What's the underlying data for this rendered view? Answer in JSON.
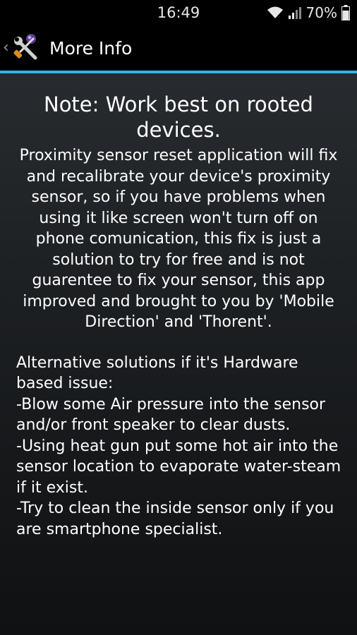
{
  "status_bar": {
    "time": "16:49",
    "battery_percent": "70%",
    "icons": [
      "wifi-icon",
      "signal-icon",
      "battery-icon"
    ]
  },
  "action_bar": {
    "title": "More Info",
    "up_indicator": "‹",
    "app_icon": "tools-icon",
    "accent_color": "#33b5e5"
  },
  "content": {
    "note": "Note: Work best on rooted devices.",
    "description": "Proximity sensor reset application will fix and recalibrate your device's proximity sensor, so if you have problems when using it like screen won't turn off on phone comunication, this fix is just a solution to try for free and is not guarentee to fix your sensor, this app improved and brought to you by 'Mobile Direction' and 'Thorent'.",
    "alternatives": {
      "heading": "Alternative solutions if it's Hardware based issue:",
      "items": [
        " -Blow some Air pressure into the sensor and/or front speaker to clear dusts.",
        " -Using heat gun put some hot air into the sensor location to evaporate water-steam if it exist.",
        " -Try to clean the inside sensor only if you are smartphone specialist."
      ]
    }
  }
}
